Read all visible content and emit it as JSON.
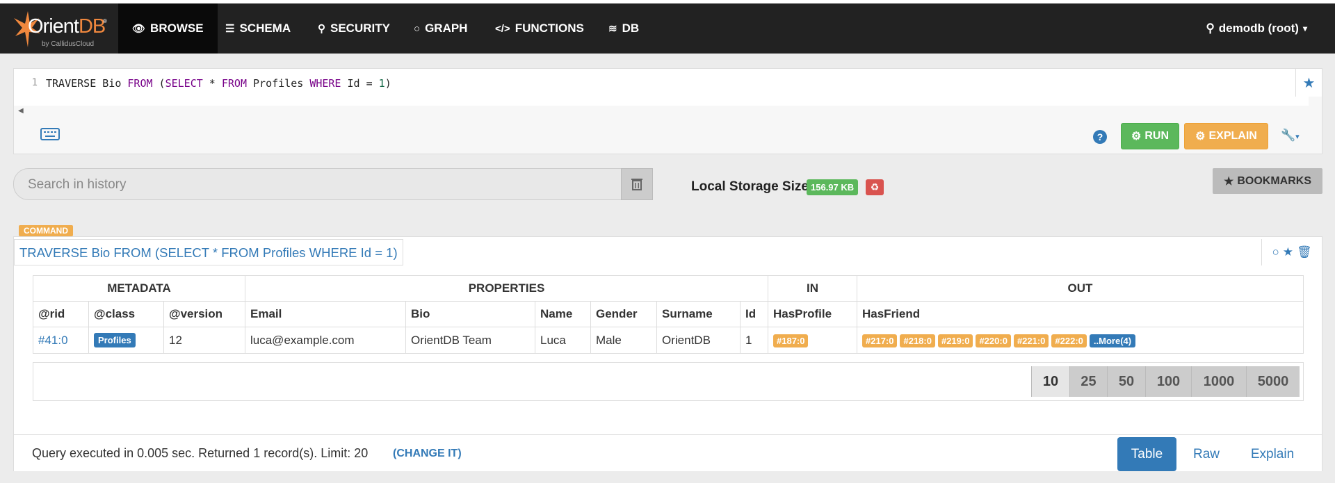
{
  "app": {
    "brand": "OrientDB",
    "brand_accent": "DB",
    "brand_sub": "by CallidusCloud",
    "accent_color": "#f0883e"
  },
  "nav": {
    "items": [
      {
        "label": "BROWSE",
        "icon": "eye-icon"
      },
      {
        "label": "SCHEMA",
        "icon": "table-icon"
      },
      {
        "label": "SECURITY",
        "icon": "user-icon"
      },
      {
        "label": "GRAPH",
        "icon": "circle-icon"
      },
      {
        "label": "FUNCTIONS",
        "icon": "code-icon"
      },
      {
        "label": "DB",
        "icon": "database-icon"
      }
    ],
    "active": "BROWSE",
    "user": "demodb (root)"
  },
  "editor": {
    "line_number": "1",
    "query": "TRAVERSE Bio FROM (SELECT * FROM Profiles WHERE Id = 1)",
    "run_label": "RUN",
    "explain_label": "EXPLAIN"
  },
  "history": {
    "placeholder": "Search in history",
    "storage_label": "Local Storage Size",
    "storage_size": "156.97 KB",
    "bookmarks_label": "BOOKMARKS"
  },
  "result": {
    "badge": "COMMAND",
    "title": "TRAVERSE Bio FROM (SELECT * FROM Profiles WHERE Id = 1)",
    "groups": [
      "METADATA",
      "PROPERTIES",
      "IN",
      "OUT"
    ],
    "columns": [
      "@rid",
      "@class",
      "@version",
      "Email",
      "Bio",
      "Name",
      "Gender",
      "Surname",
      "Id",
      "HasProfile",
      "HasFriend"
    ],
    "row": {
      "rid": "#41:0",
      "class": "Profiles",
      "version": "12",
      "email": "luca@example.com",
      "bio": "OrientDB Team",
      "name": "Luca",
      "gender": "Male",
      "surname": "OrientDB",
      "id": "1",
      "has_profile": "#187:0",
      "has_friend": [
        "#217:0",
        "#218:0",
        "#219:0",
        "#220:0",
        "#221:0",
        "#222:0"
      ],
      "more": "..More(4)"
    },
    "page_sizes": [
      "10",
      "25",
      "50",
      "100",
      "1000",
      "5000"
    ],
    "active_page_size": "10",
    "status": "Query executed in 0.005 sec. Returned 1 record(s). Limit: 20",
    "change_it": "(CHANGE IT)",
    "views": [
      "Table",
      "Raw",
      "Explain"
    ],
    "active_view": "Table"
  }
}
